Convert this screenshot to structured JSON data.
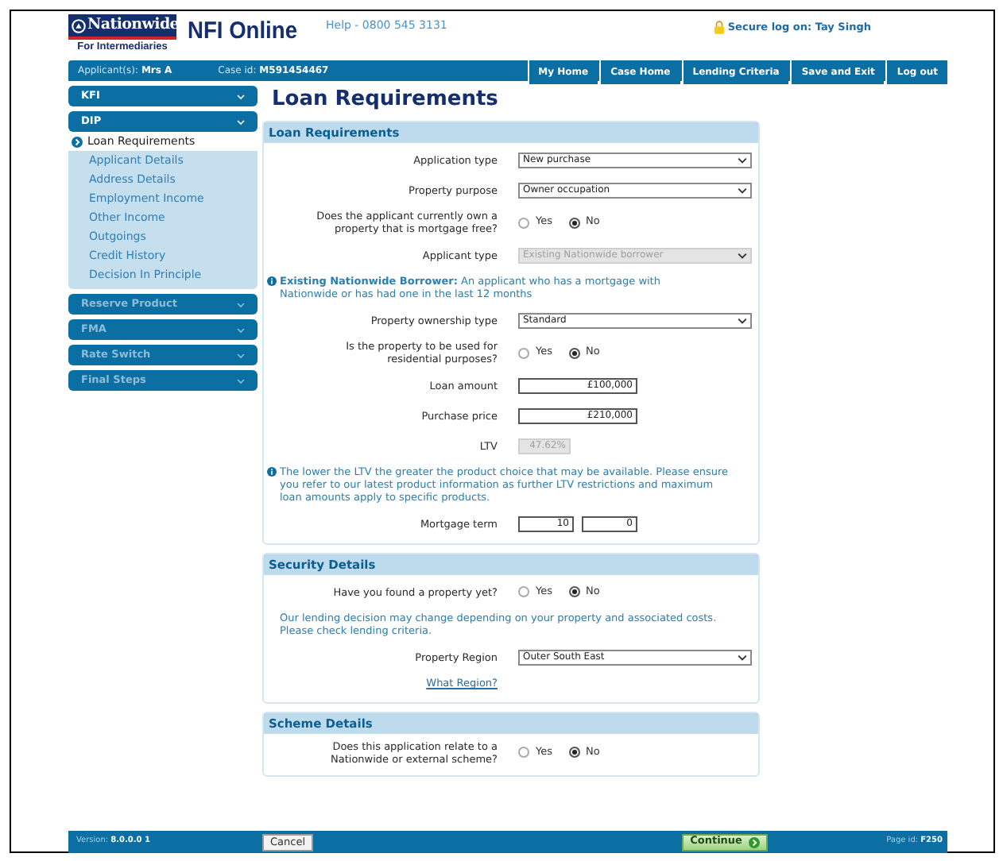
{
  "header": {
    "brand": "Nationwide",
    "brand_sub": "For Intermediaries",
    "product": "NFI Online",
    "help": "Help - 0800 545 3131",
    "secure": "Secure log on: Tay Singh"
  },
  "nav_bar": {
    "applicant_label": "Applicant(s):",
    "applicant_value": "Mrs A",
    "case_label": "Case id:",
    "case_value": "M591454467",
    "buttons": [
      "My Home",
      "Case Home",
      "Lending Criteria",
      "Save and Exit",
      "Log out"
    ]
  },
  "sidebar": [
    {
      "label": "KFI",
      "disabled": false
    },
    {
      "label": "DIP",
      "disabled": false,
      "children": [
        {
          "label": "Loan Requirements",
          "selected": true
        },
        {
          "label": "Applicant Details",
          "selected": false
        },
        {
          "label": "Address Details",
          "selected": false
        },
        {
          "label": "Employment Income",
          "selected": false
        },
        {
          "label": "Other Income",
          "selected": false
        },
        {
          "label": "Outgoings",
          "selected": false
        },
        {
          "label": "Credit History",
          "selected": false
        },
        {
          "label": "Decision In Principle",
          "selected": false
        }
      ]
    },
    {
      "label": "Reserve Product",
      "disabled": true
    },
    {
      "label": "FMA",
      "disabled": true
    },
    {
      "label": "Rate Switch",
      "disabled": true
    },
    {
      "label": "Final Steps",
      "disabled": true
    }
  ],
  "page_title": "Loan Requirements",
  "sections": [
    {
      "title": "Loan Requirements",
      "rows": [
        {
          "kind": "select",
          "label": "Application type",
          "value": "New purchase",
          "disabled": false
        },
        {
          "kind": "select",
          "label": "Property purpose",
          "value": "Owner occupation",
          "disabled": false
        },
        {
          "kind": "radio",
          "label": "Does the applicant currently own a property that is mortgage free?",
          "options": [
            {
              "label": "Yes",
              "selected": false
            },
            {
              "label": "No",
              "selected": true
            }
          ]
        },
        {
          "kind": "select",
          "label": "Applicant type",
          "value": "Existing Nationwide borrower",
          "disabled": true
        },
        {
          "kind": "info",
          "text": "**Existing Nationwide Borrower:** An applicant who has a mortgage with Nationwide or has had one in the last 12 months"
        },
        {
          "kind": "select",
          "label": "Property ownership type",
          "value": "Standard",
          "disabled": false
        },
        {
          "kind": "radio",
          "label": "Is the property to be used for residential purposes?",
          "options": [
            {
              "label": "Yes",
              "selected": false
            },
            {
              "label": "No",
              "selected": true
            }
          ]
        },
        {
          "kind": "text",
          "label": "Loan amount",
          "value": "£100,000",
          "disabled": false
        },
        {
          "kind": "text",
          "label": "Purchase price",
          "value": "£210,000",
          "disabled": false
        },
        {
          "kind": "text",
          "label": "LTV",
          "value": "47.62%",
          "disabled": true
        },
        {
          "kind": "info",
          "text": "The lower the LTV the greater the product choice that may be available. Please ensure you refer to our latest product information as further LTV restrictions and maximum loan amounts apply to specific products."
        },
        {
          "kind": "term",
          "label": "Mortgage term",
          "values": [
            "10",
            "0"
          ]
        }
      ]
    },
    {
      "title": "Security Details",
      "rows": [
        {
          "kind": "radio",
          "label": "Have you found a property yet?",
          "options": [
            {
              "label": "Yes",
              "selected": false
            },
            {
              "label": "No",
              "selected": true
            }
          ]
        },
        {
          "kind": "note",
          "text": "Our lending decision may change depending on your property and associated costs. Please check lending criteria."
        },
        {
          "kind": "select",
          "label": "Property Region",
          "value": "Outer South East",
          "disabled": false
        },
        {
          "kind": "link",
          "text": "What Region?"
        }
      ]
    },
    {
      "title": "Scheme Details",
      "rows": [
        {
          "kind": "radio",
          "label": "Does this application relate to a Nationwide or external scheme?",
          "options": [
            {
              "label": "Yes",
              "selected": false
            },
            {
              "label": "No",
              "selected": true
            }
          ]
        }
      ]
    }
  ],
  "footer": {
    "version_label": "Version:",
    "version_value": "8.0.0.0 1",
    "cancel": "Cancel",
    "continue": "Continue",
    "page_id_label": "Page id:",
    "page_id_value": "F250"
  }
}
